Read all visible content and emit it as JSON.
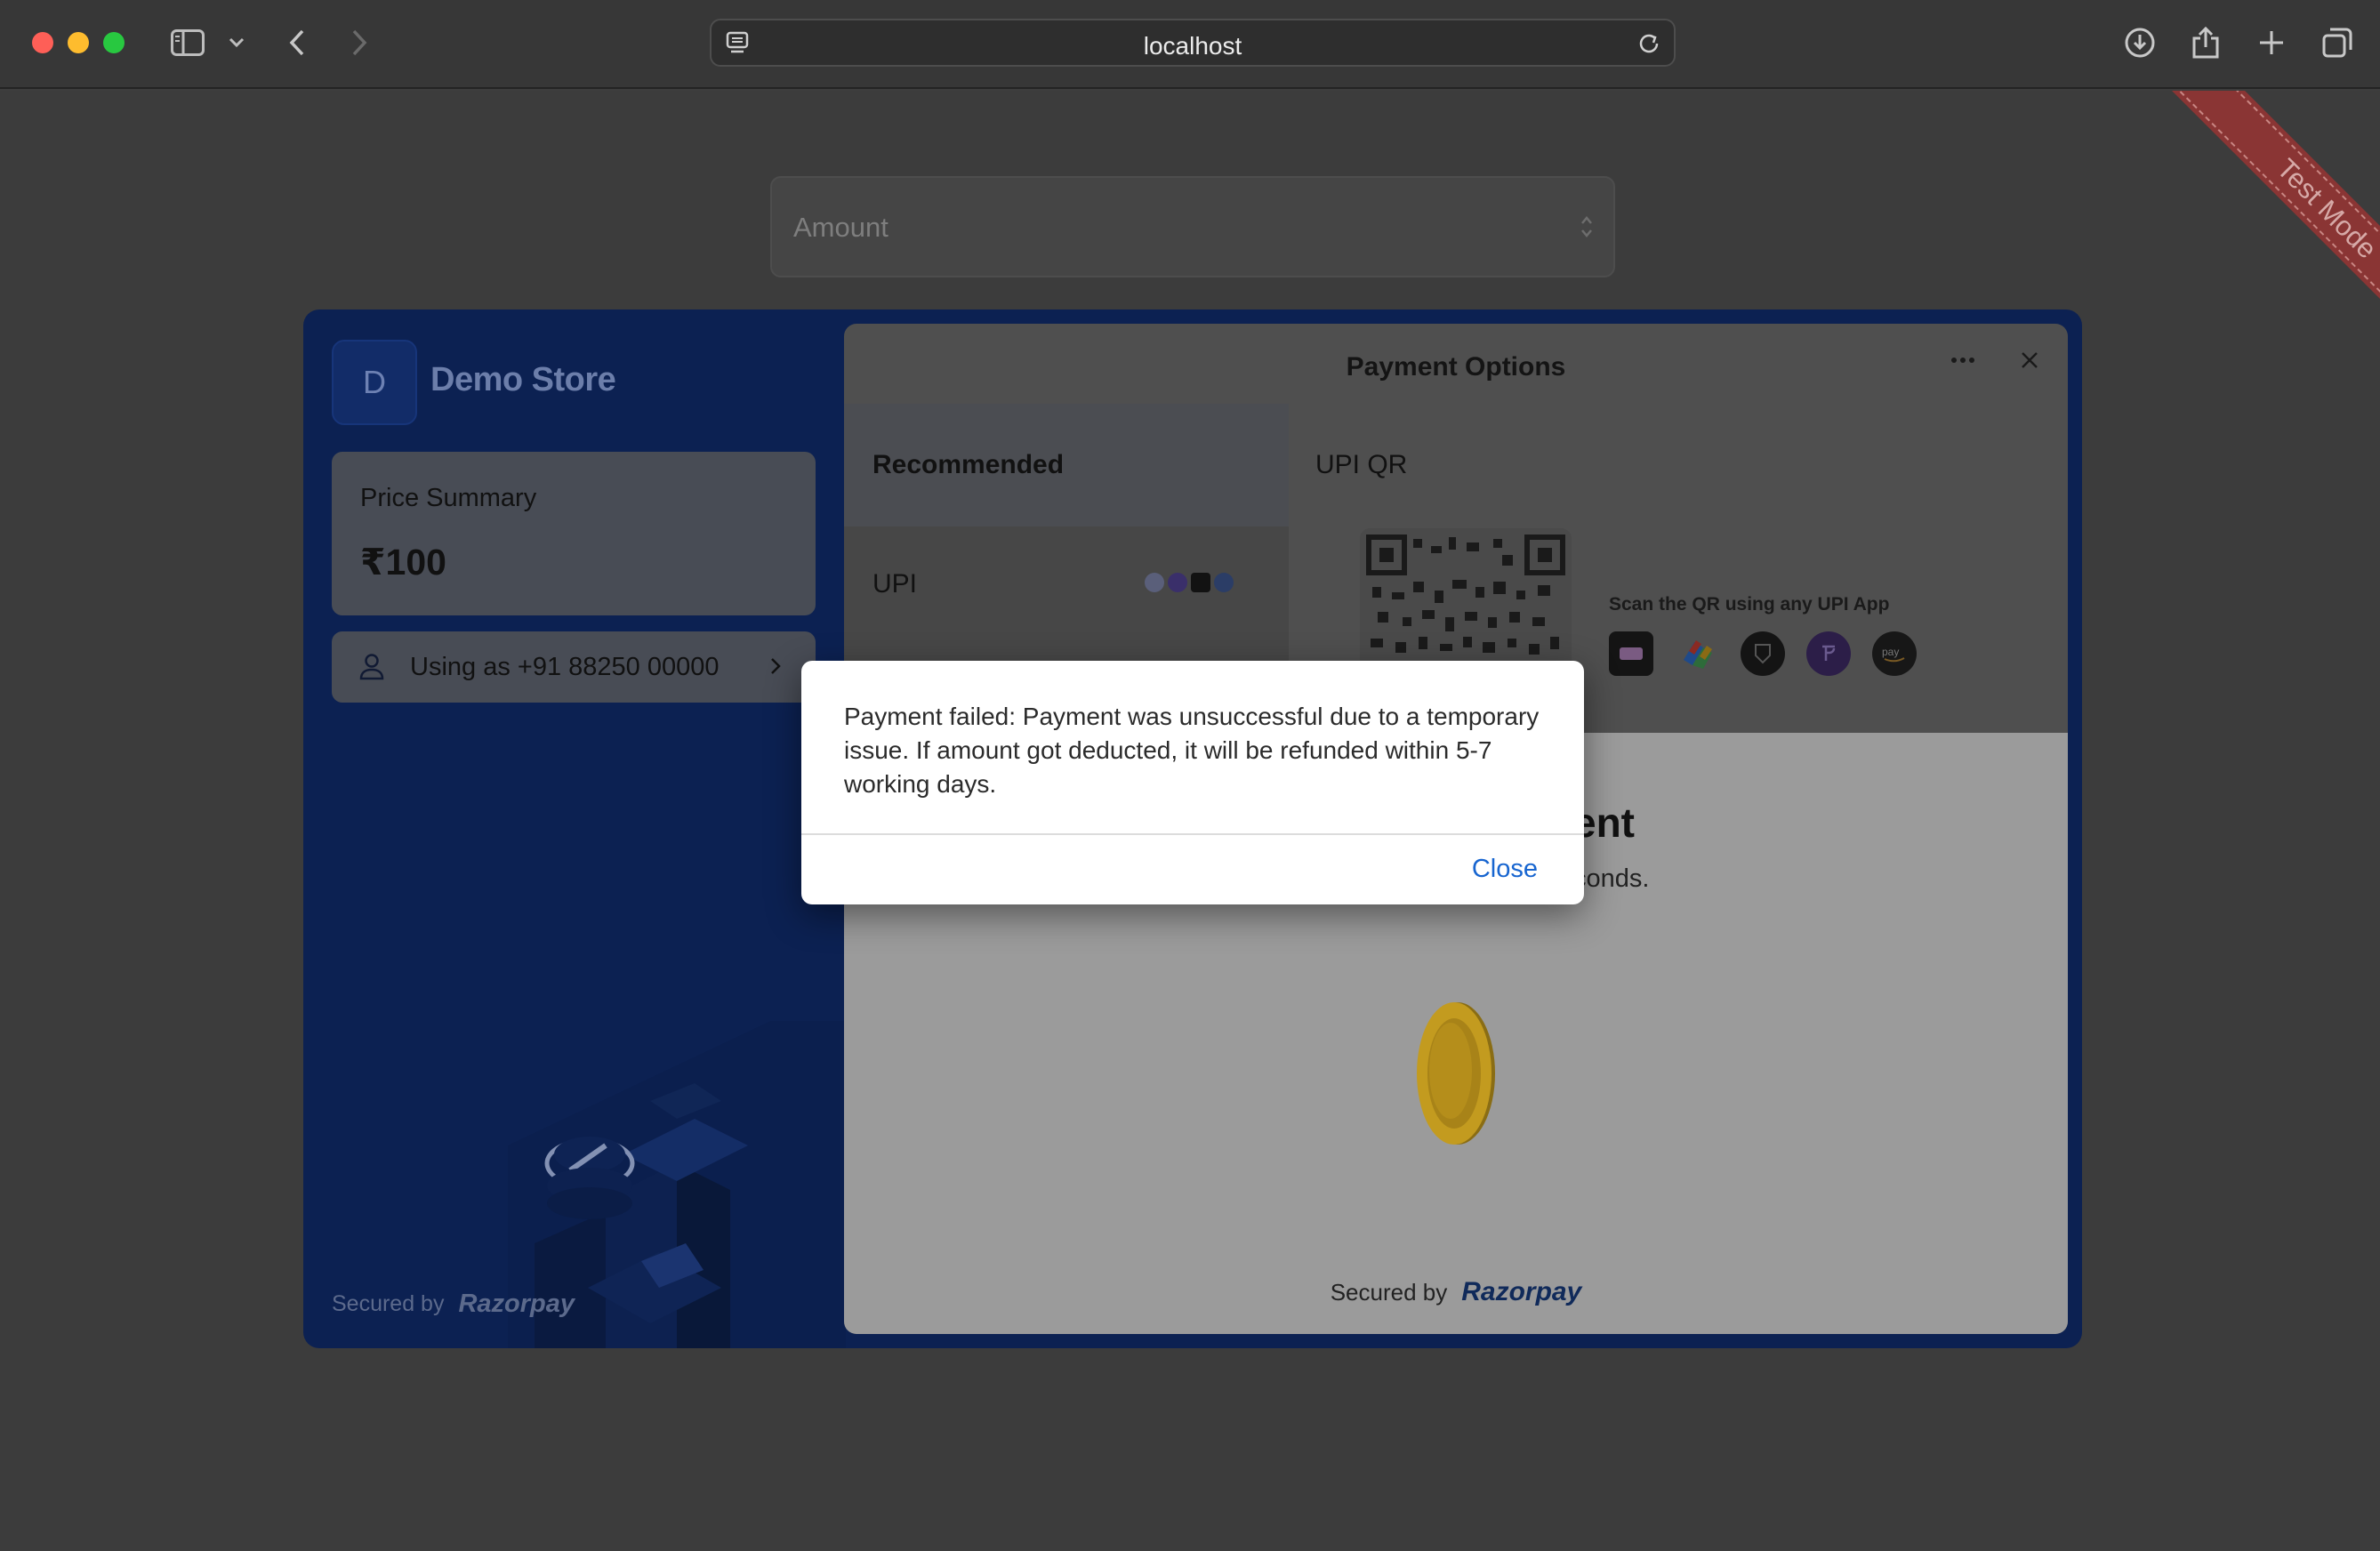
{
  "browser": {
    "url": "localhost",
    "icons": [
      "sidebar-toggle-icon",
      "chevron-down-icon",
      "back-icon",
      "forward-icon",
      "site-settings-icon",
      "reload-icon",
      "download-icon",
      "share-icon",
      "new-tab-icon",
      "tab-overview-icon"
    ]
  },
  "page": {
    "amount_placeholder": "Amount",
    "test_mode_label": "Test Mode"
  },
  "checkout": {
    "store_initial": "D",
    "store_name": "Demo Store",
    "price_summary_label": "Price Summary",
    "price_value": "₹100",
    "contact_text": "Using as +91 88250 00000",
    "secured_by": "Secured by",
    "brand_name": "Razorpay",
    "header_title": "Payment Options",
    "methods": [
      {
        "label": "Recommended"
      },
      {
        "label": "UPI"
      }
    ],
    "qr_title": "UPI QR",
    "qr_scan_text": "Scan the QR using any UPI App",
    "upi_apps": [
      "paytm-icon",
      "google-pay-icon",
      "cred-icon",
      "phonepe-icon",
      "amazon-pay-icon"
    ],
    "processing_title": "ent",
    "processing_subtitle": "conds."
  },
  "dialog": {
    "message": "Payment failed: Payment was unsuccessful due to a temporary issue. If amount got deducted, it will be refunded within 5-7 working days.",
    "close_label": "Close"
  },
  "colors": {
    "checkout_blue": "#0c2152",
    "link_blue": "#1765d0",
    "test_mode_red": "#8a3534"
  }
}
